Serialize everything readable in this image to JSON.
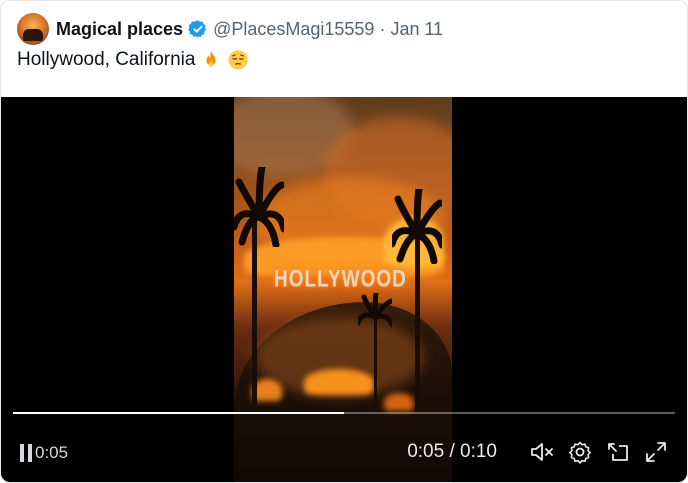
{
  "tweet": {
    "display_name": "Magical places",
    "handle": "@PlacesMagi15559",
    "separator": "·",
    "date": "Jan 11",
    "text": "Hollywood, California",
    "emojis": [
      "fire-emoji",
      "pensive-face-emoji"
    ]
  },
  "video": {
    "sign_text": "HOLLYWOOD",
    "elapsed_left": "0:05",
    "time_display": "0:05 / 0:10",
    "progress_fraction": 0.5,
    "icons": [
      "pause-icon",
      "mute-icon",
      "settings-icon",
      "pip-icon",
      "fullscreen-icon"
    ]
  },
  "colors": {
    "verified_badge": "#1d9bf0",
    "secondary_text": "#536471",
    "primary_text": "#0f1419"
  }
}
